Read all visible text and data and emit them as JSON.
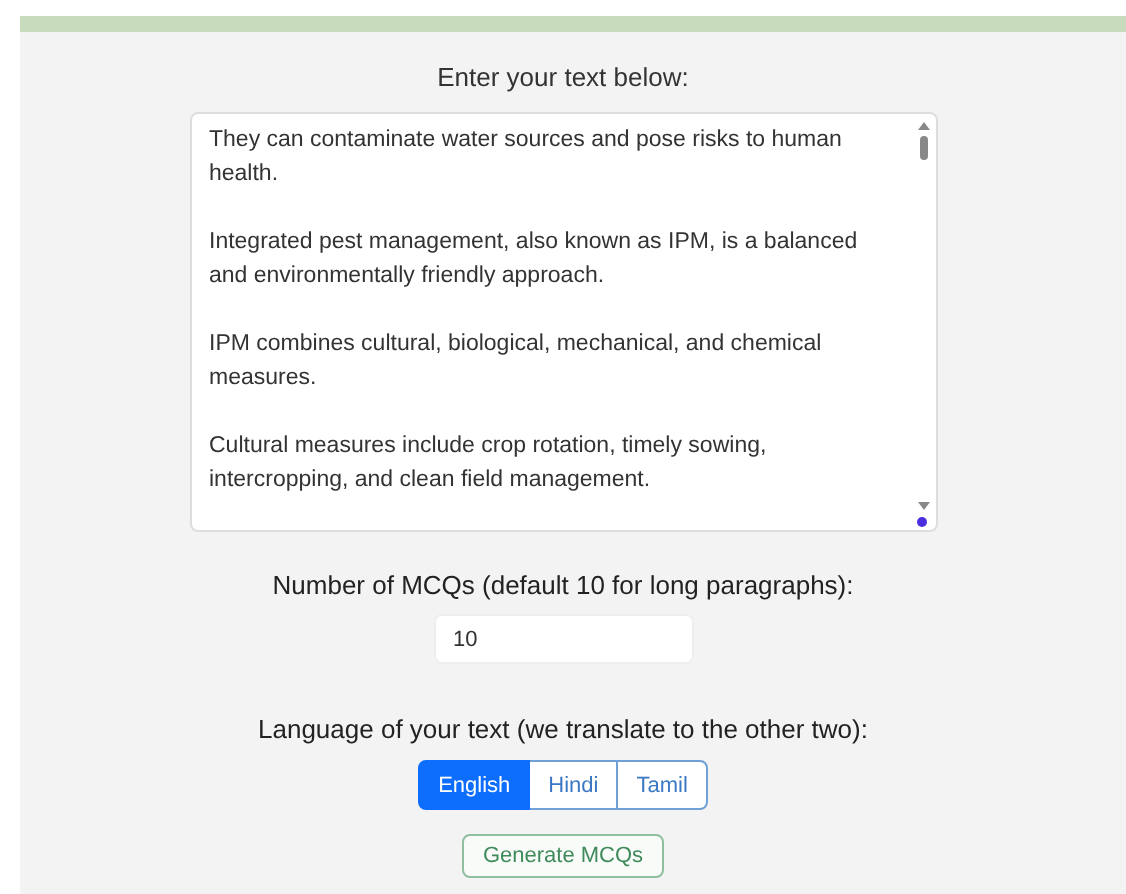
{
  "heading": "Enter your text below:",
  "text_input": {
    "value": "They can contaminate water sources and pose risks to human health.\n\nIntegrated pest management, also known as IPM, is a balanced and environmentally friendly approach.\n\nIPM combines cultural, biological, mechanical, and chemical measures.\n\nCultural measures include crop rotation, timely sowing, intercropping, and clean field management."
  },
  "mcq_count": {
    "label": "Number of MCQs (default 10 for long paragraphs):",
    "value": "10"
  },
  "language": {
    "label": "Language of your text (we translate to the other two):",
    "options": [
      {
        "label": "English",
        "selected": true
      },
      {
        "label": "Hindi",
        "selected": false
      },
      {
        "label": "Tamil",
        "selected": false
      }
    ]
  },
  "generate_button": "Generate MCQs"
}
